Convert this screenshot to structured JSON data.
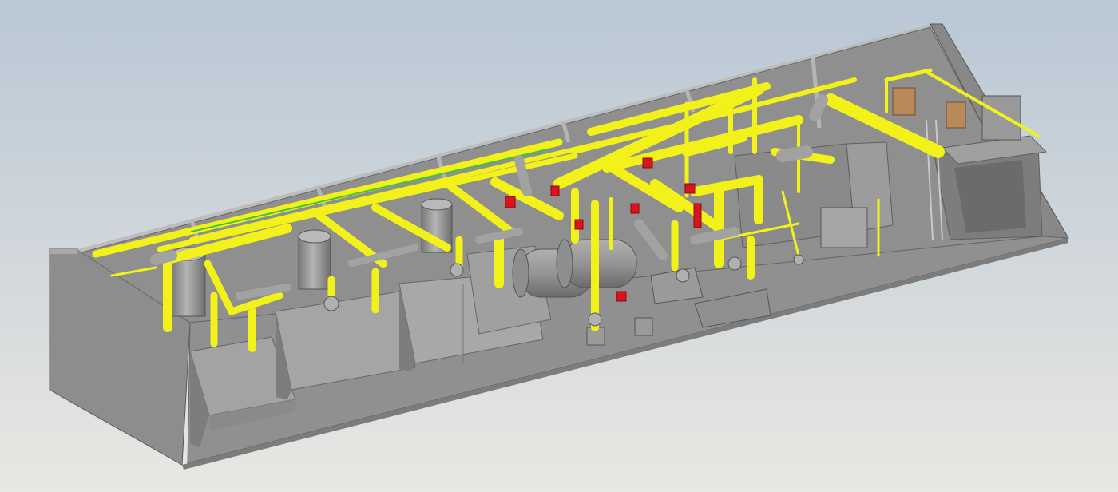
{
  "viewport": {
    "background_top": "#bccad6",
    "background_bottom": "#e6e6e6"
  },
  "model": {
    "wall_color": "#8c8c8c",
    "floor_color": "#8e8e8e",
    "pipe_color": "#f2f21a",
    "valve_color": "#d9141c",
    "equipment_color": "#9a9a9a",
    "pipe_accent_color": "#3ec43e",
    "door_color": "#b88a5a"
  }
}
